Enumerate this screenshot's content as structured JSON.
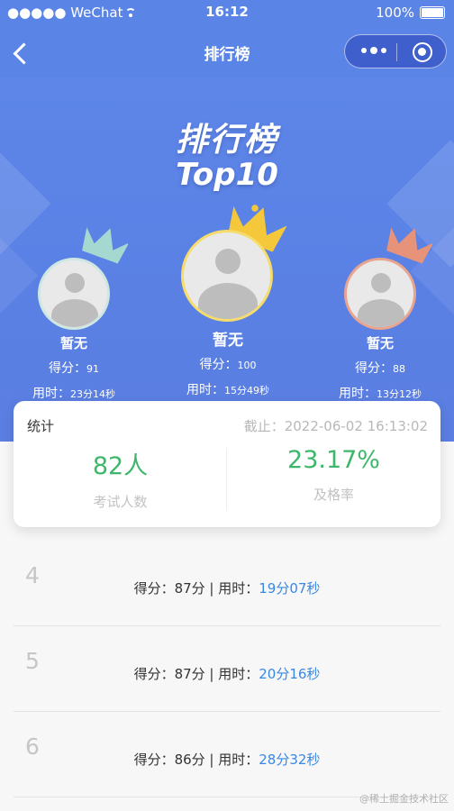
{
  "status_bar": {
    "carrier": "●●●●● WeChat",
    "time": "16:12",
    "battery": "100%"
  },
  "nav": {
    "title": "排行榜"
  },
  "hero": {
    "title": "排行榜",
    "subtitle": "Top10"
  },
  "podium": [
    {
      "place": 2,
      "name": "暂无",
      "score_label": "得分：",
      "score": "91",
      "time_label": "用时：",
      "time": "23分14秒",
      "crown_color": "#a6d8d2"
    },
    {
      "place": 1,
      "name": "暂无",
      "score_label": "得分：",
      "score": "100",
      "time_label": "用时：",
      "time": "15分49秒",
      "crown_color": "#f5c73a"
    },
    {
      "place": 3,
      "name": "暂无",
      "score_label": "得分：",
      "score": "88",
      "time_label": "用时：",
      "time": "13分12秒",
      "crown_color": "#e7937a"
    }
  ],
  "stats": {
    "label": "统计",
    "deadline": "截止：2022-06-02 16:13:02",
    "participants": "82人",
    "participants_label": "考试人数",
    "pass_rate": "23.17%",
    "pass_rate_label": "及格率"
  },
  "list": [
    {
      "rank": "4",
      "score_text": "得分：87分 | 用时：",
      "time": "19分07秒"
    },
    {
      "rank": "5",
      "score_text": "得分：87分 | 用时：",
      "time": "20分16秒"
    },
    {
      "rank": "6",
      "score_text": "得分：86分 | 用时：",
      "time": "28分32秒"
    }
  ],
  "watermark": "@稀土掘金技术社区",
  "colors": {
    "primary": "#5b84e7",
    "pass_green": "#3db86a",
    "time_blue": "#3a87e3"
  }
}
